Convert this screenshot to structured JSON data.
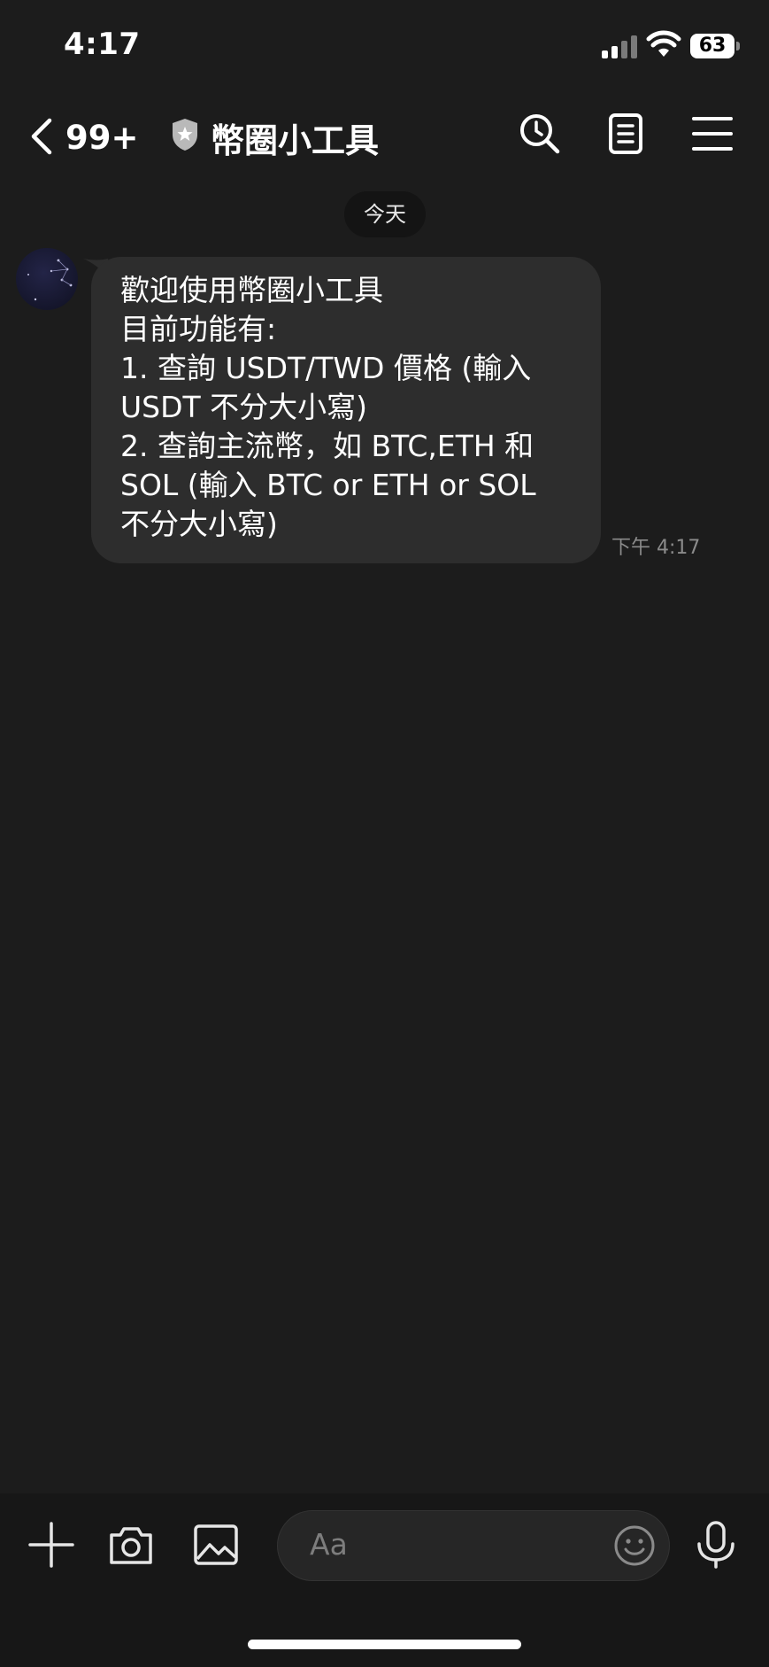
{
  "status_bar": {
    "time": "4:17",
    "battery": "63",
    "signal_icon": "cellular-signal-icon",
    "wifi_icon": "wifi-icon"
  },
  "header": {
    "back_icon": "chevron-left-icon",
    "unread_count": "99+",
    "badge_icon": "shield-star-icon",
    "title": "幣圈小工具",
    "actions": [
      "search-icon",
      "notes-icon",
      "menu-icon"
    ]
  },
  "chat": {
    "date_label": "今天",
    "messages": [
      {
        "sender": "bot",
        "lines": [
          "歡迎使用幣圈小工具",
          "目前功能有:",
          "1. 查詢 USDT/TWD 價格 (輸入",
          "USDT 不分大小寫)",
          "2. 查詢主流幣，如 BTC,ETH 和",
          "SOL (輸入 BTC or ETH or SOL",
          "不分大小寫)"
        ],
        "time": "下午 4:17"
      }
    ]
  },
  "input_bar": {
    "placeholder": "Aa",
    "icons": [
      "plus-icon",
      "camera-icon",
      "image-icon",
      "emoji-icon",
      "microphone-icon"
    ]
  },
  "colors": {
    "background": "#1c1c1c",
    "bubble": "#2d2d2d",
    "input_bar": "#171717",
    "timestamp": "#8b8b8b"
  }
}
